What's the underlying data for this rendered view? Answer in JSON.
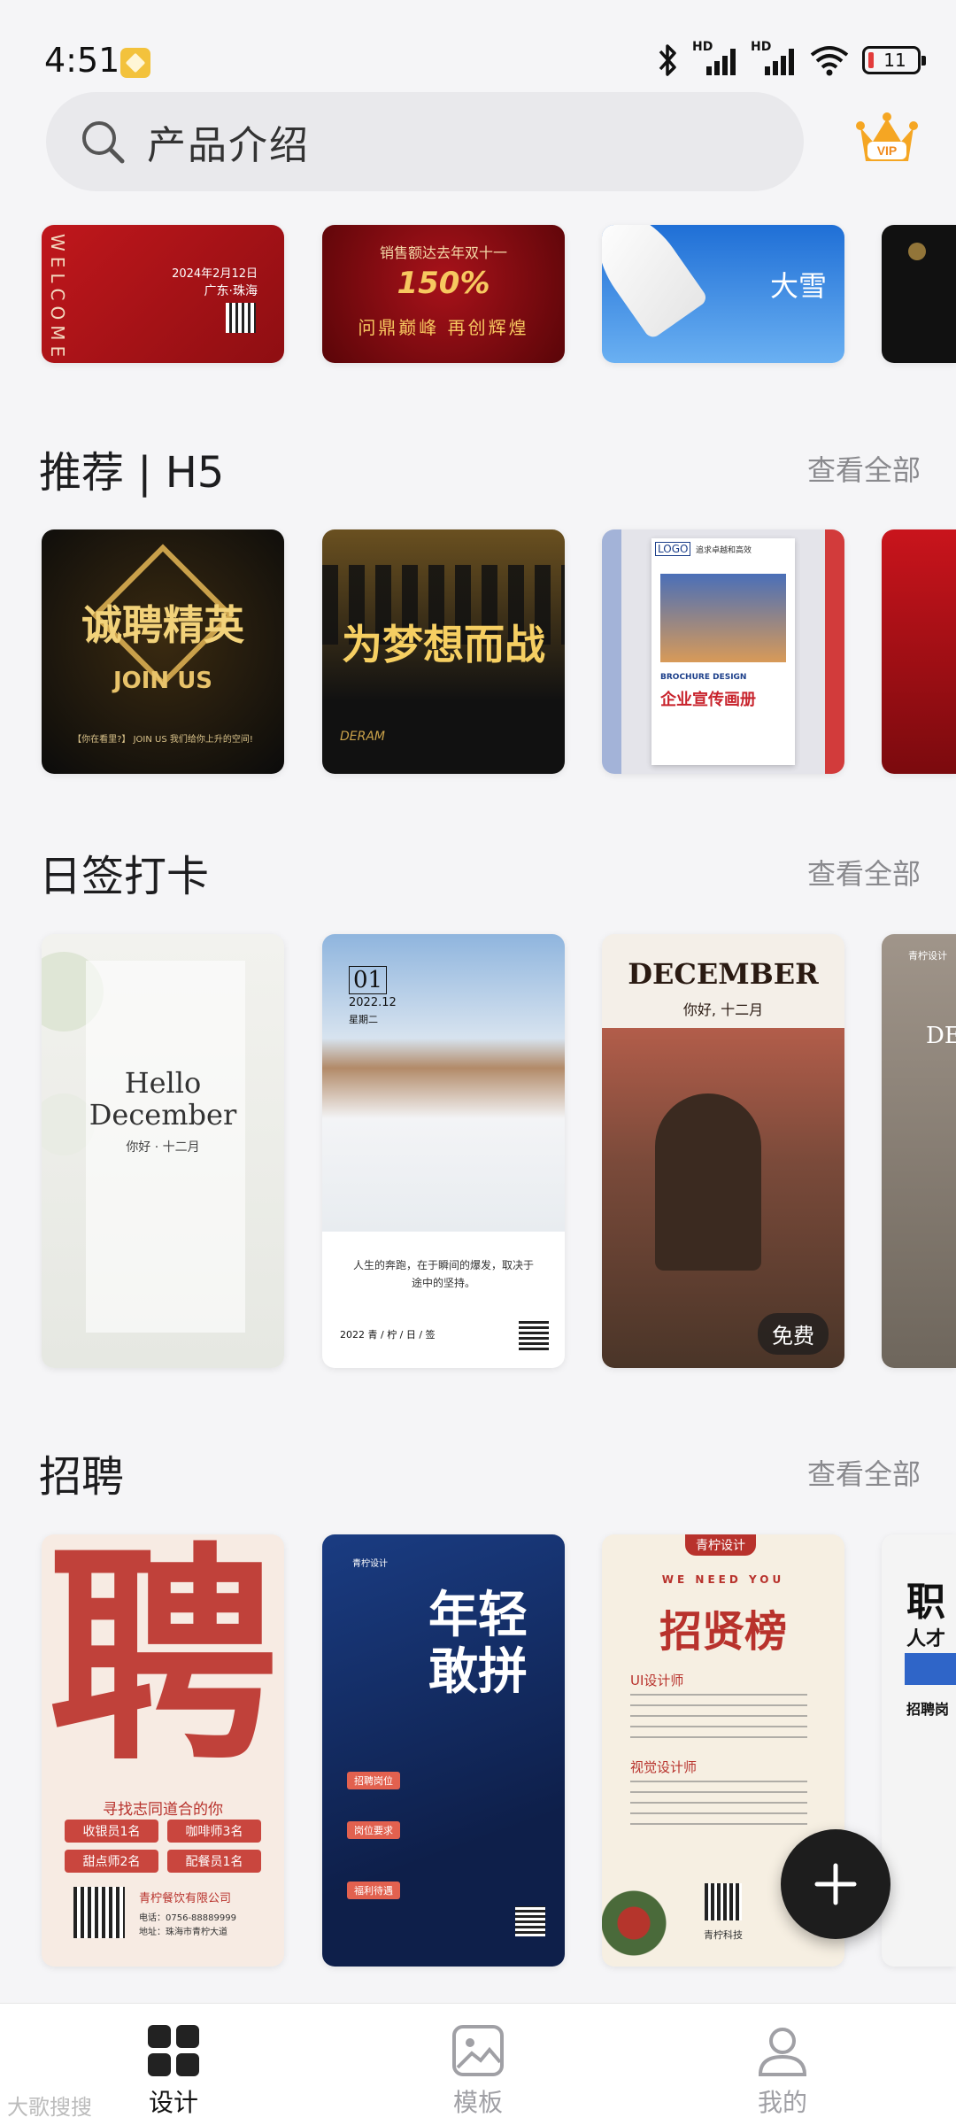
{
  "status_bar": {
    "time": "4:51",
    "signal_label_1": "HD",
    "signal_label_2": "HD",
    "battery": "11"
  },
  "search": {
    "text": "产品介绍"
  },
  "vip": {
    "label": "VIP"
  },
  "top_row": {
    "card1": {
      "side_text": "WELCOME",
      "date": "2024年2月12日",
      "place": "广东·珠海"
    },
    "card2": {
      "line1": "销售额达去年双十一",
      "percent": "150%",
      "slogan": "问鼎巅峰 再创辉煌"
    },
    "card3": {
      "title": "大雪"
    }
  },
  "sections": {
    "h5": {
      "title": "推荐 | H5",
      "see_all": "查看全部"
    },
    "daily": {
      "title": "日签打卡",
      "see_all": "查看全部"
    },
    "recruit": {
      "title": "招聘",
      "see_all": "查看全部"
    }
  },
  "h5_row": {
    "card1": {
      "title": "诚聘精英",
      "sub": "JOIN US",
      "tag": "【你在看里?】 JOIN US 我们给你上升的空间!"
    },
    "card2": {
      "title": "为梦想而战",
      "sub": "DERAM"
    },
    "card3": {
      "logo": "LOGO",
      "header": "追求卓越和高效",
      "eng": "BROCHURE DESIGN",
      "title": "企业宣传画册"
    }
  },
  "daily_row": {
    "card1": {
      "title": "Hello December",
      "sub": "你好 · 十二月"
    },
    "card2": {
      "day": "01",
      "date": "2022.12",
      "weekday": "星期二",
      "quote": "人生的奔跑，在于瞬间的爆发，取决于途中的坚持。",
      "year": "2022 青 / 柠 / 日 / 签"
    },
    "card3": {
      "title": "DECEMBER",
      "sub": "你好, 十二月",
      "badge": "免费"
    },
    "card4": {
      "brand": "青柠设计",
      "title": "DE"
    }
  },
  "recruit_row": {
    "card1": {
      "big": "聘",
      "line": "寻找志同道合的你",
      "jobs": [
        "收银员1名",
        "咖啡师3名",
        "甜点师2名",
        "配餐员1名"
      ],
      "company": "青柠餐饮有限公司",
      "phone": "电话：0756-88889999",
      "address": "地址：珠海市青柠大道"
    },
    "card2": {
      "brand": "青柠设计",
      "title": "年轻敢拼",
      "tag1": "招聘岗位",
      "tag2": "岗位要求",
      "tag3": "福利待遇"
    },
    "card3": {
      "brand": "青柠设计",
      "eng": "WE NEED YOU",
      "title": "招贤榜",
      "job1": "UI设计师",
      "job2": "视觉设计师",
      "footer": "青柠科技"
    },
    "card4": {
      "title": "职",
      "sub": "人才",
      "line": "招聘岗"
    }
  },
  "bottom_nav": {
    "design": "设计",
    "template": "模板",
    "mine": "我的"
  },
  "watermark": "大歌搜搜"
}
